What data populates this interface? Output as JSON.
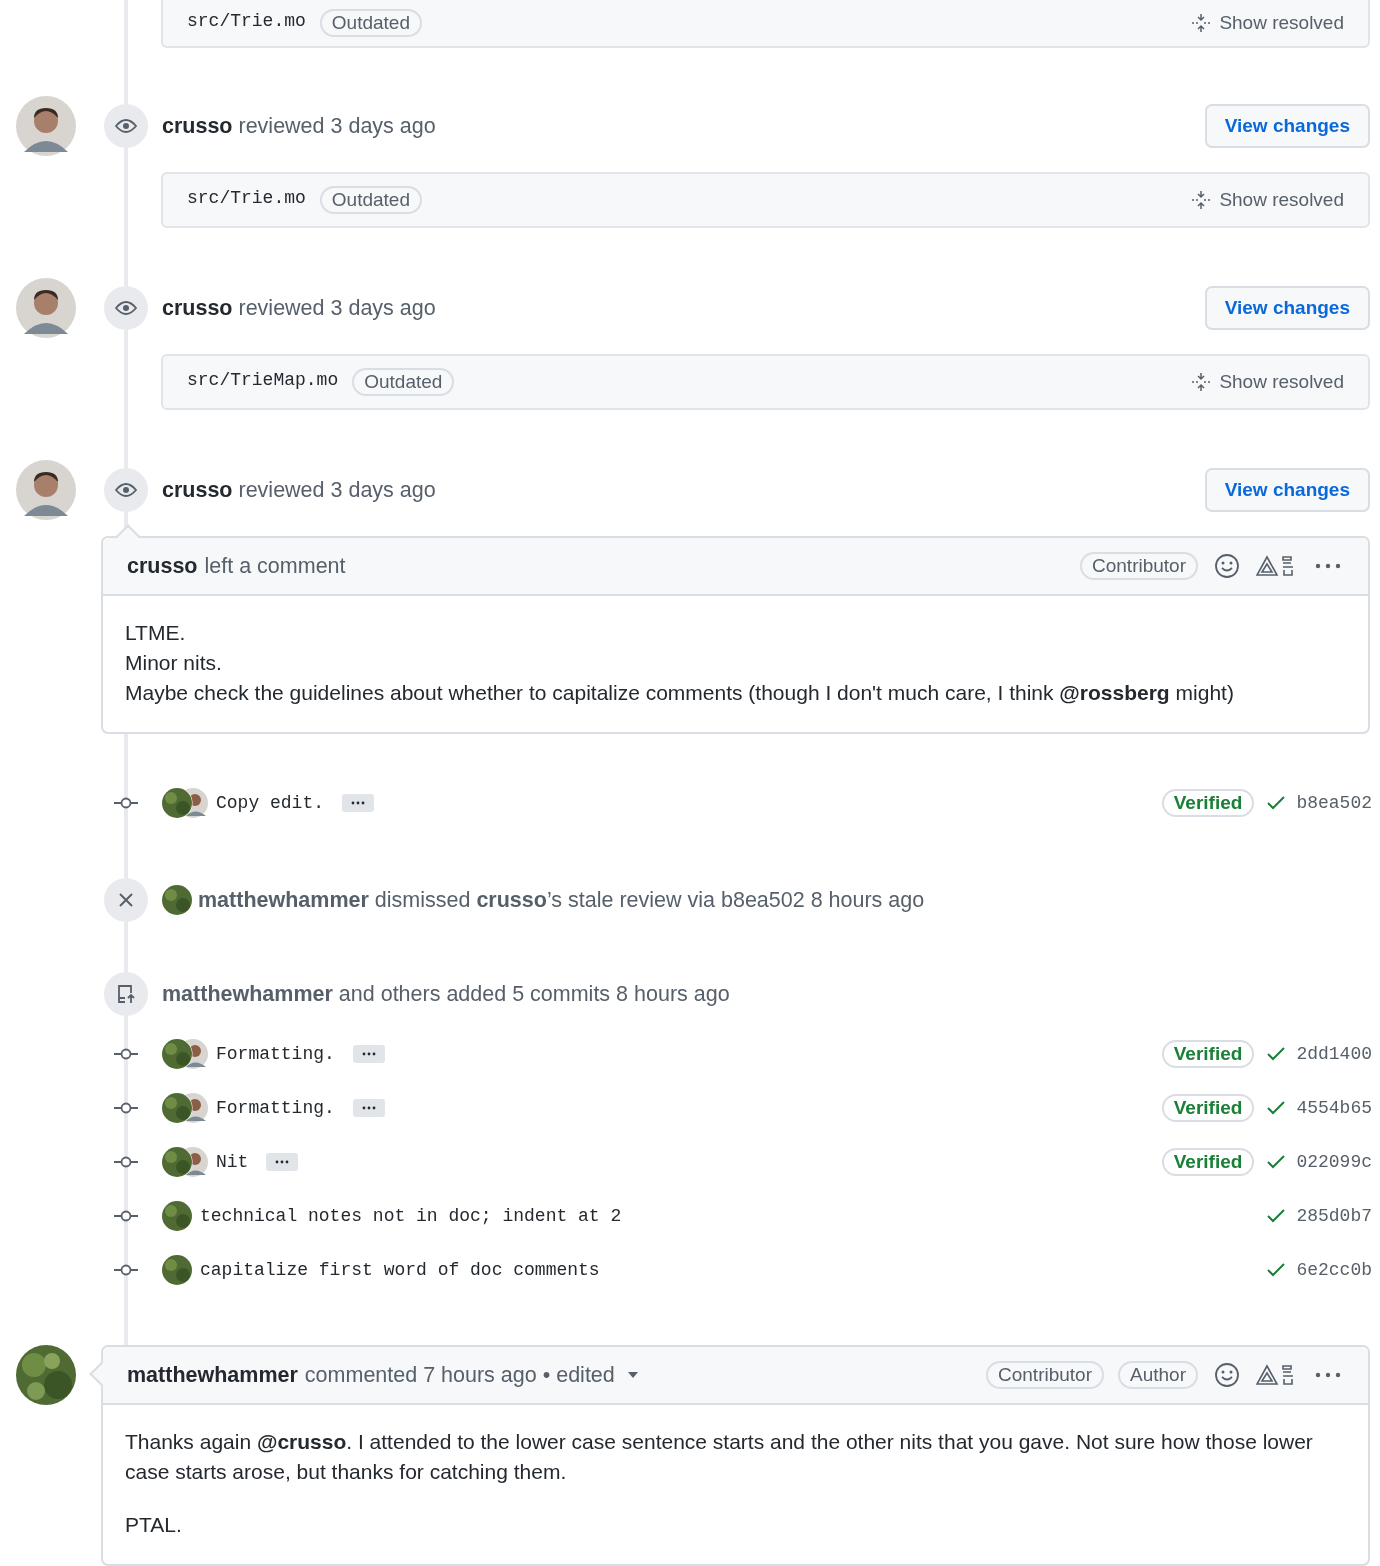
{
  "timeline": [
    {
      "kind": "file",
      "path": "src/Trie.mo",
      "label": "Outdated",
      "action": "Show resolved",
      "cut": true
    },
    {
      "kind": "review",
      "user": "crusso",
      "text": "reviewed 3 days ago",
      "button": "View changes"
    },
    {
      "kind": "file",
      "path": "src/Trie.mo",
      "label": "Outdated",
      "action": "Show resolved",
      "cut": false
    },
    {
      "kind": "review",
      "user": "crusso",
      "text": "reviewed 3 days ago",
      "button": "View changes"
    },
    {
      "kind": "file",
      "path": "src/TrieMap.mo",
      "label": "Outdated",
      "action": "Show resolved",
      "cut": false
    },
    {
      "kind": "review",
      "user": "crusso",
      "text": "reviewed 3 days ago",
      "button": "View changes"
    },
    {
      "kind": "comment",
      "avatar": false,
      "user": "crusso",
      "meta": "left a comment",
      "edited": false,
      "badges": [
        "Contributor"
      ],
      "paragraphs": [
        [
          "LTME.",
          "Minor nits.",
          "Maybe check the guidelines about whether to capitalize comments (though I don't much care, I think **@rossberg** might)"
        ]
      ]
    },
    {
      "kind": "commit",
      "coauthored": true,
      "message": "Copy edit.",
      "more": true,
      "verified": "Verified",
      "sha": "b8ea502"
    },
    {
      "kind": "dismissed",
      "text": "**matthewhammer** dismissed **crusso**’s stale review via b8ea502 8 hours ago"
    },
    {
      "kind": "pushed",
      "text": "**matthewhammer** and others added 5 commits 8 hours ago"
    },
    {
      "kind": "commit",
      "coauthored": true,
      "message": "Formatting.",
      "more": true,
      "verified": "Verified",
      "sha": "2dd1400"
    },
    {
      "kind": "commit",
      "coauthored": true,
      "message": "Formatting.",
      "more": true,
      "verified": "Verified",
      "sha": "4554b65"
    },
    {
      "kind": "commit",
      "coauthored": true,
      "message": "Nit",
      "more": true,
      "verified": "Verified",
      "sha": "022099c"
    },
    {
      "kind": "commit",
      "coauthored": false,
      "message": "technical notes not in doc; indent at 2",
      "more": false,
      "sha": "285d0b7"
    },
    {
      "kind": "commit",
      "coauthored": false,
      "message": "capitalize first word of doc comments",
      "more": false,
      "sha": "6e2cc0b"
    },
    {
      "kind": "comment",
      "avatar": true,
      "user": "matthewhammer",
      "meta": "commented 7 hours ago • edited",
      "edited": true,
      "badges": [
        "Contributor",
        "Author"
      ],
      "paragraphs": [
        [
          "Thanks again **@crusso**. I attended to the lower case sentence starts and the other nits that you gave. Not sure how those lower case starts arose, but thanks for catching them."
        ],
        [
          "PTAL."
        ]
      ]
    }
  ]
}
